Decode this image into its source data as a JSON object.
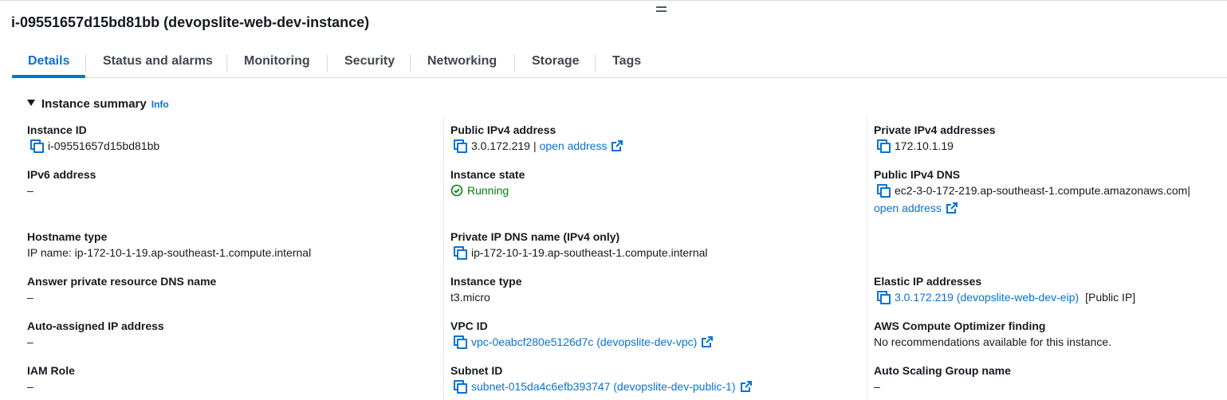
{
  "instance_title": "i-09551657d15bd81bb (devopslite-web-dev-instance)",
  "tabs": [
    {
      "label": "Details",
      "active": true
    },
    {
      "label": "Status and alarms"
    },
    {
      "label": "Monitoring"
    },
    {
      "label": "Security"
    },
    {
      "label": "Networking"
    },
    {
      "label": "Storage"
    },
    {
      "label": "Tags"
    }
  ],
  "summary": {
    "title": "Instance summary",
    "info": "Info"
  },
  "fields": {
    "instance_id": {
      "label": "Instance ID",
      "value": "i-09551657d15bd81bb"
    },
    "ipv6": {
      "label": "IPv6 address",
      "value": "–"
    },
    "hostname_type": {
      "label": "Hostname type",
      "value": "IP name: ip-172-10-1-19.ap-southeast-1.compute.internal"
    },
    "answer_dns": {
      "label": "Answer private resource DNS name",
      "value": "–"
    },
    "auto_ip": {
      "label": "Auto-assigned IP address",
      "value": "–"
    },
    "iam_role": {
      "label": "IAM Role",
      "value": "–"
    },
    "public_ipv4": {
      "label": "Public IPv4 address",
      "value": "3.0.172.219",
      "separator": "|",
      "link": "open address"
    },
    "instance_state": {
      "label": "Instance state",
      "value": "Running"
    },
    "private_dns": {
      "label": "Private IP DNS name (IPv4 only)",
      "value": "ip-172-10-1-19.ap-southeast-1.compute.internal"
    },
    "instance_type": {
      "label": "Instance type",
      "value": "t3.micro"
    },
    "vpc_id": {
      "label": "VPC ID",
      "value": "vpc-0eabcf280e5126d7c (devopslite-dev-vpc)"
    },
    "subnet_id": {
      "label": "Subnet ID",
      "value": "subnet-015da4c6efb393747 (devopslite-dev-public-1)"
    },
    "private_ipv4": {
      "label": "Private IPv4 addresses",
      "value": "172.10.1.19"
    },
    "public_dns": {
      "label": "Public IPv4 DNS",
      "value": "ec2-3-0-172-219.ap-southeast-1.compute.amazonaws.com",
      "separator": "|",
      "link": "open address"
    },
    "elastic_ip": {
      "label": "Elastic IP addresses",
      "value": "3.0.172.219 (devopslite-web-dev-eip)",
      "suffix": "[Public IP]"
    },
    "optimizer": {
      "label": "AWS Compute Optimizer finding",
      "value": "No recommendations available for this instance."
    },
    "asg": {
      "label": "Auto Scaling Group name",
      "value": "–"
    }
  },
  "colors": {
    "link": "#0972d3",
    "success": "#037f0c",
    "text": "#16191f",
    "divider": "#d5dbdb"
  },
  "icons": [
    "drag-handle-icon",
    "caret-down-icon",
    "copy-icon",
    "external-link-icon",
    "status-success-icon"
  ]
}
